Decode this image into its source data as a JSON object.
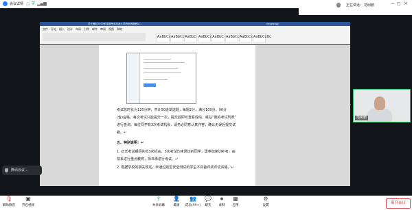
{
  "window": {
    "title": "会议详情"
  },
  "speaking_top": {
    "label": "正在讲话:",
    "name": "范树鹏"
  },
  "word": {
    "title": "关于做好2023年全国专业技术人员职业资格考试…",
    "user": "rongrongy",
    "tabs": [
      "文件",
      "开始",
      "插入",
      "设计",
      "布局",
      "引用",
      "邮件",
      "审阅",
      "视图",
      "帮助"
    ],
    "styles": [
      "AaBbCcDc",
      "AaBbCcDc",
      "AaBbC",
      "AaBbCc",
      "AaBbC",
      "AaBbCc",
      "AaBbCcDc",
      "AaBbCcDc"
    ],
    "doc_lines": [
      "考试总时长为120分钟，共计50道单选题，每题2分，满分100分，96分",
      "(含)合格。每次考试只能提交一次，提交后即可查看成绩，或在“我的考试列表”",
      "进行查询。每位同学有3次考试机会，请务必同意认真作答，确认无误后提交试",
      "卷。↵",
      "五、特别说明：↵",
      "1. 正式考试期间共有3次机会，3次考试均未通过的同学，需参加复训补考，由",
      "院系进行重点教育，择日再进行考试。↵",
      "2. 根据学校的相关规定，未通过航空安全测试的学生不具备评奖评优资格。↵"
    ]
  },
  "participant": {
    "name": "范树鹏"
  },
  "speaking_bottom": {
    "label": "腾讯会议..."
  },
  "toolbar": {
    "items": [
      "解除静音",
      "开启视频",
      "共享屏幕",
      "邀请",
      "成员(99+)",
      "聊天",
      "录制",
      "应用",
      "设置"
    ],
    "leave": "离开会议"
  },
  "colors": {
    "accent": "#2ac26b",
    "danger": "#e24b4b",
    "word_blue": "#2b579a"
  }
}
